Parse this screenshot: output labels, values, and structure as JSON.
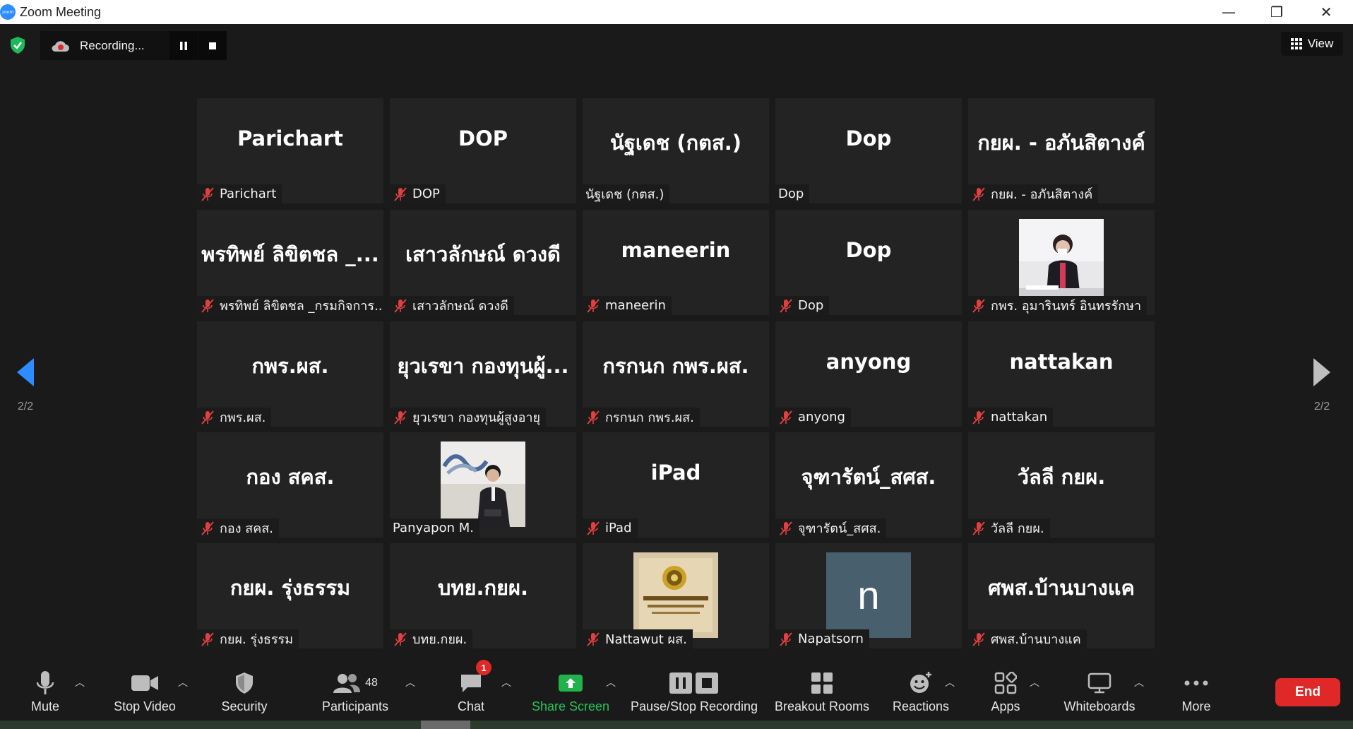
{
  "window": {
    "title": "Zoom Meeting",
    "logo_text": "zoom",
    "minimize_glyph": "—",
    "restore_glyph": "❐",
    "close_glyph": "✕"
  },
  "recording": {
    "text": "Recording..."
  },
  "view_button": {
    "label": "View"
  },
  "pagination": {
    "left": "2/2",
    "right": "2/2"
  },
  "participants": [
    {
      "display": "Parichart",
      "label": "Parichart",
      "muted": true
    },
    {
      "display": "DOP",
      "label": "DOP",
      "muted": true
    },
    {
      "display": "นัฐเดช (กตส.)",
      "label": "นัฐเดช (กตส.)",
      "muted": false
    },
    {
      "display": "Dop",
      "label": "Dop",
      "muted": false
    },
    {
      "display": "กยผ. - อภันสิตางค์",
      "label": "กยผ. - อภันสิตางค์",
      "muted": true
    },
    {
      "display": "พรทิพย์ ลิขิตชล _...",
      "label": "พรทิพย์ ลิขิตชล _กรมกิจการ...",
      "muted": true
    },
    {
      "display": "เสาวลักษณ์ ดวงดี",
      "label": "เสาวลักษณ์ ดวงดี",
      "muted": true
    },
    {
      "display": "maneerin",
      "label": "maneerin",
      "muted": true
    },
    {
      "display": "Dop",
      "label": "Dop",
      "muted": true
    },
    {
      "display": "",
      "label": "กพร. อุมารินทร์ อินทรรักษา",
      "muted": true,
      "video": "woman-at-desk"
    },
    {
      "display": "กพร.ผส.",
      "label": "กพร.ผส.",
      "muted": true
    },
    {
      "display": "ยุวเรขา กองทุนผู้...",
      "label": "ยุวเรขา กองทุนผู้สูงอายุ",
      "muted": true
    },
    {
      "display": "กรกนก กพร.ผส.",
      "label": "กรกนก กพร.ผส.",
      "muted": true
    },
    {
      "display": "anyong",
      "label": "anyong",
      "muted": true
    },
    {
      "display": "nattakan",
      "label": "nattakan",
      "muted": true
    },
    {
      "display": "กอง สคส.",
      "label": "กอง สคส.",
      "muted": true
    },
    {
      "display": "",
      "label": "Panyapon M.",
      "muted": false,
      "video": "man-with-artwork"
    },
    {
      "display": "iPad",
      "label": "iPad",
      "muted": true
    },
    {
      "display": "จุฑารัตน์_สศส.",
      "label": "จุฑารัตน์_สศส.",
      "muted": true
    },
    {
      "display": "วัลลี กยผ.",
      "label": "วัลลี กยผ.",
      "muted": true
    },
    {
      "display": "กยผ. รุ่งธรรม",
      "label": "กยผ. รุ่งธรรม",
      "muted": true
    },
    {
      "display": "บทย.กยผ.",
      "label": "บทย.กยผ.",
      "muted": true
    },
    {
      "display": "",
      "label": "Nattawut ผส.",
      "muted": true,
      "video": "emblem-sign"
    },
    {
      "display": "",
      "label": "Napatsorn",
      "muted": true,
      "avatar_letter": "n"
    },
    {
      "display": "ศพส.บ้านบางแค",
      "label": "ศพส.บ้านบางแค",
      "muted": true
    }
  ],
  "toolbar": {
    "mute": "Mute",
    "stop_video": "Stop Video",
    "security": "Security",
    "participants": "Participants",
    "participants_count": "48",
    "chat": "Chat",
    "chat_badge": "1",
    "share_screen": "Share Screen",
    "pause_recording": "Pause/Stop Recording",
    "breakout_rooms": "Breakout Rooms",
    "reactions": "Reactions",
    "apps": "Apps",
    "whiteboards": "Whiteboards",
    "more": "More",
    "end": "End"
  },
  "colors": {
    "share_green": "#22b24c",
    "end_red": "#e02828",
    "mute_red": "#e04040",
    "arrow_blue": "#2d8cff",
    "avatar_slate": "#48606e"
  }
}
